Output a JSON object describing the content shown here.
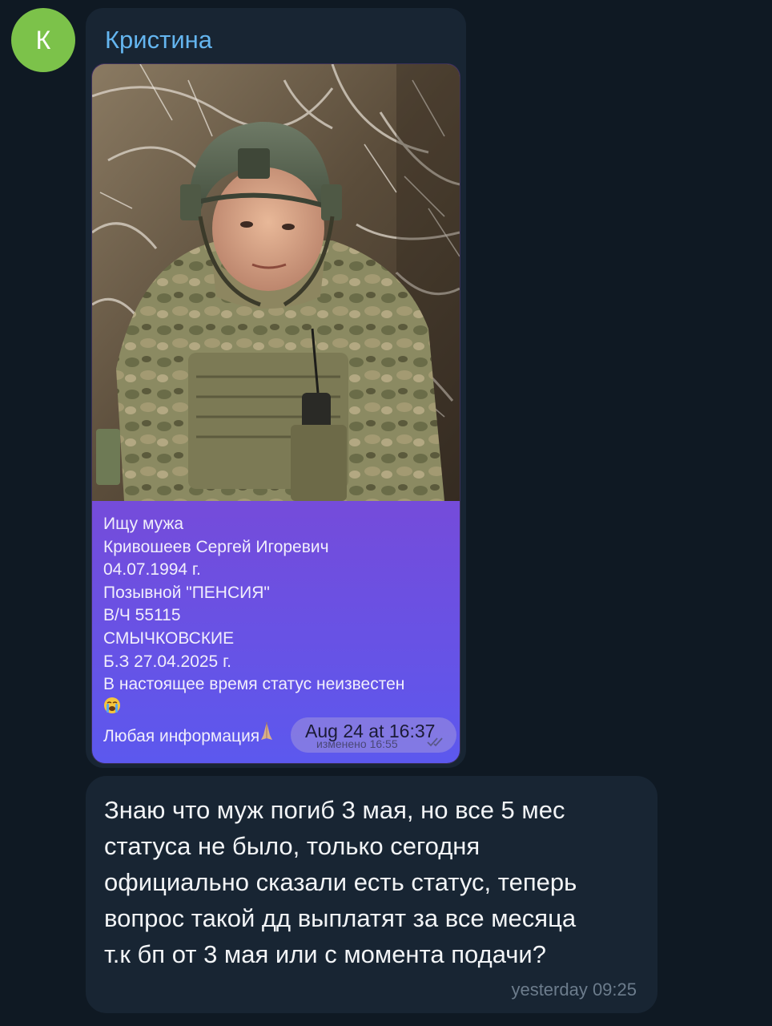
{
  "contact": {
    "avatar_letter": "К",
    "avatar_color": "#7cc24a",
    "name": "Кристина",
    "name_color": "#64b5ef"
  },
  "photo_message": {
    "image_description_icon": "soldier-photo",
    "caption_lines": [
      "Ищу мужа",
      "Кривошеев Сергей Игоревич",
      "04.07.1994 г.",
      "Позывной \"ПЕНСИЯ\"",
      "В/Ч 55115",
      "СМЫЧКОВСКИЕ",
      "Б.З 27.04.2025 г.",
      "В настоящее время статус неизвестен"
    ],
    "last_line": "Любая информация",
    "emoji_cry": "crying-face-icon",
    "emoji_pray": "praying-hands-icon",
    "timestamp": "Aug 24 at 16:37",
    "edited_label": "изменено 16:55",
    "read_status": "double-check-icon"
  },
  "text_message": {
    "lines": [
      "Знаю что муж погиб 3 мая, но все 5 мес",
      "статуса не было, только сегодня",
      "официально сказали есть статус, теперь",
      "вопрос такой дд выплатят за все месяца",
      "т.к бп от 3 мая или с момента подачи?"
    ],
    "timestamp": "yesterday 09:25"
  },
  "colors": {
    "background": "#0f1923",
    "bubble": "#182533",
    "caption_gradient_top": "#8a43c8",
    "caption_gradient_bottom": "#5c58ee"
  }
}
